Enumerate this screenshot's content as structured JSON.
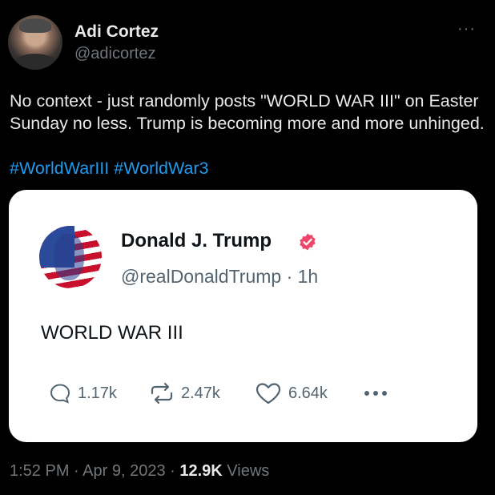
{
  "tweet": {
    "author_name": "Adi Cortez",
    "author_handle": "@adicortez",
    "more_label": "···",
    "text": "No context - just randomly posts \"WORLD WAR III\" on Easter Sunday no less. Trump is becoming more and more unhinged.",
    "hashtags": [
      "#WorldWarIII",
      "#WorldWar3"
    ]
  },
  "card": {
    "name": "Donald J. Trump",
    "handle_meta": "@realDonaldTrump · 1h",
    "text": "WORLD WAR III",
    "actions": {
      "replies": "1.17k",
      "reposts": "2.47k",
      "likes": "6.64k"
    },
    "verified_color": "#f0456b"
  },
  "footer": {
    "time": "1:52 PM",
    "sep1": " · ",
    "date": "Apr 9, 2023",
    "sep2": " · ",
    "views_count": "12.9K",
    "views_label": " Views"
  },
  "colors": {
    "background": "#000000",
    "text_primary": "#e7e9ea",
    "text_secondary": "#71767b",
    "hashtag": "#1d9bf0",
    "card_bg": "#ffffff"
  }
}
